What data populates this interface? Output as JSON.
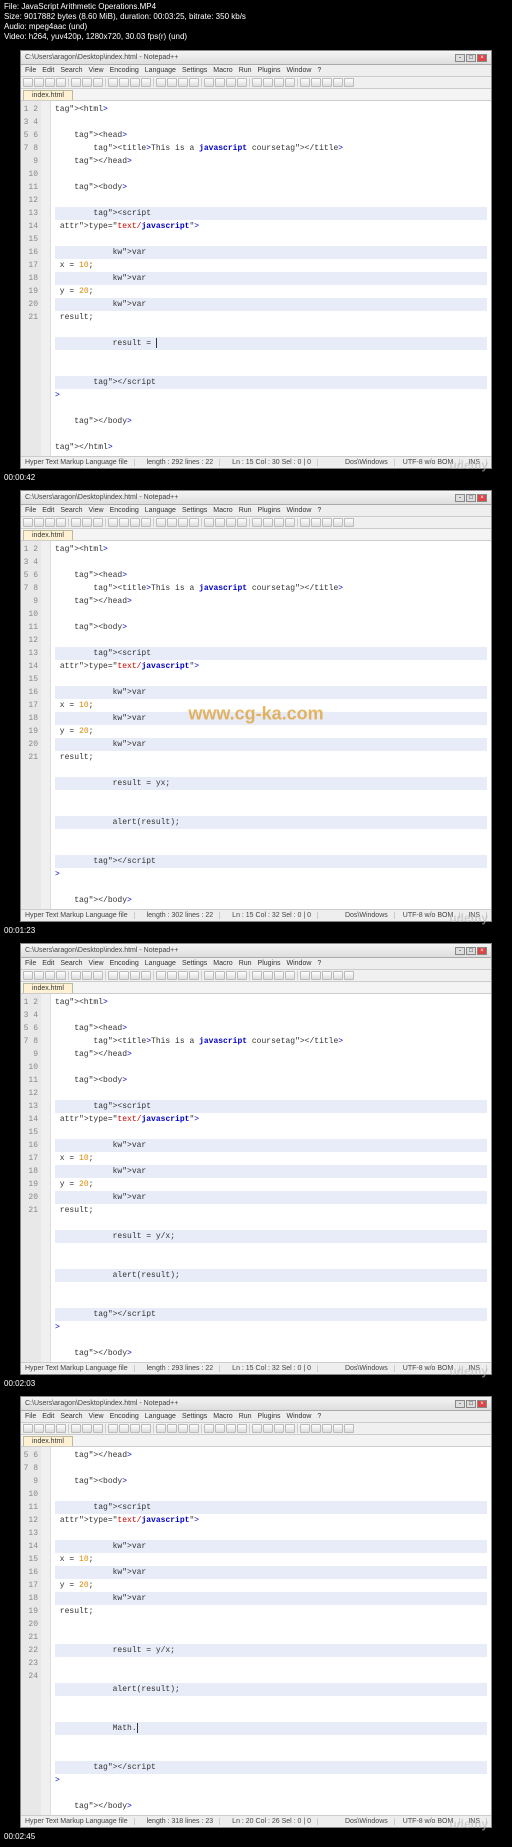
{
  "header": {
    "file": "File: JavaScript Arithmetic Operations.MP4",
    "size": "Size: 9017882 bytes (8.60 MiB), duration: 00:03:25, bitrate: 350 kb/s",
    "audio": "Audio: mpeg4aac (und)",
    "video": "Video: h264, yuv420p, 1280x720, 30.03 fps(r) (und)"
  },
  "menus": [
    "File",
    "Edit",
    "Search",
    "View",
    "Encoding",
    "Language",
    "Settings",
    "Macro",
    "Run",
    "Plugins",
    "Window",
    "?"
  ],
  "titlebar": "C:\\Users\\aragon\\Desktop\\index.html - Notepad++",
  "tab": "index.html",
  "status": {
    "filetype": "Hyper Text Markup Language file",
    "eol": "Dos\\Windows",
    "enc": "UTF-8 w/o BOM",
    "ins": "INS"
  },
  "frames": [
    {
      "timestamp": "00:00:42",
      "status_len": "length : 292   lines : 22",
      "status_pos": "Ln : 15   Col : 30   Sel : 0 | 0",
      "lines": [
        {
          "n": 1,
          "t": "<html>"
        },
        {
          "n": 2,
          "t": ""
        },
        {
          "n": 3,
          "t": "    <head>"
        },
        {
          "n": 4,
          "t": "        <title>This is a javascript course</title>"
        },
        {
          "n": 5,
          "t": "    </head>"
        },
        {
          "n": 6,
          "t": ""
        },
        {
          "n": 7,
          "t": "    <body>"
        },
        {
          "n": 8,
          "t": ""
        },
        {
          "n": 9,
          "t": "        <script type=\"text/javascript\">",
          "hl": true
        },
        {
          "n": 10,
          "t": "",
          "hl": true
        },
        {
          "n": 11,
          "t": "            var x = 10;",
          "hl": true
        },
        {
          "n": 12,
          "t": "            var y = 20;",
          "hl": true
        },
        {
          "n": 13,
          "t": "            var result;",
          "hl": true
        },
        {
          "n": 14,
          "t": "",
          "hl": true
        },
        {
          "n": 15,
          "t": "            result = |",
          "hl": true
        },
        {
          "n": 16,
          "t": "",
          "hl": true
        },
        {
          "n": 17,
          "t": "        </scr_ipt>",
          "hl": true
        },
        {
          "n": 18,
          "t": ""
        },
        {
          "n": 19,
          "t": "    </body>"
        },
        {
          "n": 20,
          "t": ""
        },
        {
          "n": 21,
          "t": "</html>"
        }
      ]
    },
    {
      "timestamp": "00:01:23",
      "watermark": "www.cg-ka.com",
      "status_len": "length : 302   lines : 22",
      "status_pos": "Ln : 15   Col : 32   Sel : 0 | 0",
      "lines": [
        {
          "n": 1,
          "t": "<html>"
        },
        {
          "n": 2,
          "t": ""
        },
        {
          "n": 3,
          "t": "    <head>"
        },
        {
          "n": 4,
          "t": "        <title>This is a javascript course</title>"
        },
        {
          "n": 5,
          "t": "    </head>"
        },
        {
          "n": 6,
          "t": ""
        },
        {
          "n": 7,
          "t": "    <body>"
        },
        {
          "n": 8,
          "t": ""
        },
        {
          "n": 9,
          "t": "        <script type=\"text/javascript\">",
          "hl": true
        },
        {
          "n": 10,
          "t": "",
          "hl": true
        },
        {
          "n": 11,
          "t": "            var x = 10;",
          "hl": true
        },
        {
          "n": 12,
          "t": "            var y = 20;",
          "hl": true
        },
        {
          "n": 13,
          "t": "            var result;",
          "hl": true
        },
        {
          "n": 14,
          "t": "",
          "hl": true
        },
        {
          "n": 15,
          "t": "            result = yx;",
          "hl": true
        },
        {
          "n": 16,
          "t": "",
          "hl": true
        },
        {
          "n": 17,
          "t": "            alert(result);",
          "hl": true
        },
        {
          "n": 18,
          "t": "",
          "hl": true
        },
        {
          "n": 19,
          "t": "        </scr_ipt>",
          "hl": true
        },
        {
          "n": 20,
          "t": ""
        },
        {
          "n": 21,
          "t": "    </body>"
        }
      ]
    },
    {
      "timestamp": "00:02:03",
      "status_len": "length : 293   lines : 22",
      "status_pos": "Ln : 15   Col : 32   Sel : 0 | 0",
      "lines": [
        {
          "n": 1,
          "t": "<html>"
        },
        {
          "n": 2,
          "t": ""
        },
        {
          "n": 3,
          "t": "    <head>"
        },
        {
          "n": 4,
          "t": "        <title>This is a javascript course</title>"
        },
        {
          "n": 5,
          "t": "    </head>"
        },
        {
          "n": 6,
          "t": ""
        },
        {
          "n": 7,
          "t": "    <body>"
        },
        {
          "n": 8,
          "t": ""
        },
        {
          "n": 9,
          "t": "        <script type=\"text/javascript\">",
          "hl": true
        },
        {
          "n": 10,
          "t": "",
          "hl": true
        },
        {
          "n": 11,
          "t": "            var x = 10;",
          "hl": true
        },
        {
          "n": 12,
          "t": "            var y = 20;",
          "hl": true
        },
        {
          "n": 13,
          "t": "            var result;",
          "hl": true
        },
        {
          "n": 14,
          "t": "",
          "hl": true
        },
        {
          "n": 15,
          "t": "            result = y/x;",
          "hl": true
        },
        {
          "n": 16,
          "t": "",
          "hl": true
        },
        {
          "n": 17,
          "t": "            alert(result);",
          "hl": true
        },
        {
          "n": 18,
          "t": "",
          "hl": true
        },
        {
          "n": 19,
          "t": "        </scr_ipt>",
          "hl": true
        },
        {
          "n": 20,
          "t": ""
        },
        {
          "n": 21,
          "t": "    </body>"
        }
      ]
    },
    {
      "timestamp": "00:02:45",
      "status_len": "length : 318   lines : 23",
      "status_pos": "Ln : 20   Col : 26   Sel : 0 | 0",
      "lines": [
        {
          "n": 5,
          "t": "    </head>"
        },
        {
          "n": 6,
          "t": ""
        },
        {
          "n": 7,
          "t": "    <body>"
        },
        {
          "n": 8,
          "t": ""
        },
        {
          "n": 9,
          "t": "        <script type=\"text/javascript\">",
          "hl": true
        },
        {
          "n": 10,
          "t": "",
          "hl": true
        },
        {
          "n": 11,
          "t": "            var x = 10;",
          "hl": true
        },
        {
          "n": 12,
          "t": "            var y = 20;",
          "hl": true
        },
        {
          "n": 13,
          "t": "            var result;",
          "hl": true
        },
        {
          "n": 14,
          "t": "",
          "hl": true
        },
        {
          "n": 15,
          "t": "",
          "hl": true
        },
        {
          "n": 16,
          "t": "            result = y/x;",
          "hl": true
        },
        {
          "n": 17,
          "t": "",
          "hl": true
        },
        {
          "n": 18,
          "t": "            alert(result);",
          "hl": true
        },
        {
          "n": 19,
          "t": "",
          "hl": true
        },
        {
          "n": 20,
          "t": "            Math.|",
          "hl": true
        },
        {
          "n": 21,
          "t": "",
          "hl": true
        },
        {
          "n": 22,
          "t": "        </scr_ipt>",
          "hl": true
        },
        {
          "n": 23,
          "t": ""
        },
        {
          "n": 24,
          "t": "    </body>"
        }
      ]
    }
  ],
  "udemy": "udemy"
}
